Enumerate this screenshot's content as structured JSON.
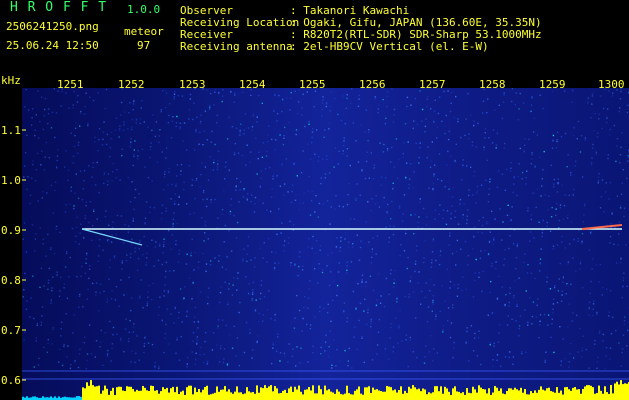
{
  "title": {
    "logo": "H R O F F T",
    "version": "1.0.0",
    "filename": "2506241250.png",
    "datetime": "25.06.24 12:50",
    "category": "meteor",
    "count": "97"
  },
  "info": [
    {
      "label": "Observer",
      "value": ": Takanori Kawachi"
    },
    {
      "label": "Receiving Location",
      "value": ": Ogaki, Gifu, JAPAN (136.60E, 35.35N)"
    },
    {
      "label": "Receiver",
      "value": ": R820T2(RTL-SDR) SDR-Sharp 53.1000MHz"
    },
    {
      "label": "Receiving antenna",
      "value": ": 2el-HB9CV Vertical (el. E-W)"
    }
  ],
  "y_axis": {
    "unit": "kHz",
    "ticks": [
      "1.1",
      "1.0",
      "0.9",
      "0.8",
      "0.7",
      "0.6"
    ]
  },
  "x_axis": {
    "ticks": [
      "1251",
      "1252",
      "1253",
      "1254",
      "1255",
      "1256",
      "1257",
      "1258",
      "1259",
      "1300"
    ]
  },
  "colors": {
    "background": "#000000",
    "text_yellow": "#ffff33",
    "text_green": "#33ff66",
    "spectrum_base": "#0a1a8c",
    "signal_line": "#e0ffff",
    "level_bar": "#ffff00",
    "baseline_cyan": "#00e0ff"
  }
}
